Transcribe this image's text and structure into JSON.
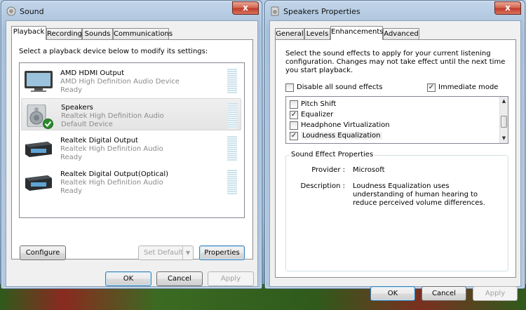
{
  "sound_window": {
    "title": "Sound",
    "close_glyph": "x",
    "tabs": [
      "Playback",
      "Recording",
      "Sounds",
      "Communications"
    ],
    "instruction": "Select a playback device below to modify its settings:",
    "devices": [
      {
        "name": "AMD HDMI Output",
        "driver": "AMD High Definition Audio Device",
        "status": "Ready",
        "icon": "monitor-icon"
      },
      {
        "name": "Speakers",
        "driver": "Realtek High Definition Audio",
        "status": "Default Device",
        "icon": "speaker-icon"
      },
      {
        "name": "Realtek Digital Output",
        "driver": "Realtek High Definition Audio",
        "status": "Ready",
        "icon": "digital-receiver-icon"
      },
      {
        "name": "Realtek Digital Output(Optical)",
        "driver": "Realtek High Definition Audio",
        "status": "Ready",
        "icon": "digital-receiver-icon"
      }
    ],
    "configure_label": "Configure",
    "set_default_label": "Set Default",
    "properties_label": "Properties",
    "ok_label": "OK",
    "cancel_label": "Cancel",
    "apply_label": "Apply"
  },
  "speakers_window": {
    "title": "Speakers Properties",
    "close_glyph": "x",
    "tabs": [
      "General",
      "Levels",
      "Enhancements",
      "Advanced"
    ],
    "instruction": "Select the sound effects to apply for your current listening configuration. Changes may not take effect until the next time you start playback.",
    "disable_all_label": "Disable all sound effects",
    "disable_all_checked": false,
    "immediate_mode_label": "Immediate mode",
    "immediate_mode_checked": true,
    "effects": [
      {
        "label": "Pitch Shift",
        "checked": false
      },
      {
        "label": "Equalizer",
        "checked": true
      },
      {
        "label": "Headphone Virtualization",
        "checked": false
      },
      {
        "label": "Loudness Equalization",
        "checked": true
      }
    ],
    "group_title": "Sound Effect Properties",
    "provider_label": "Provider :",
    "provider_value": "Microsoft",
    "description_label": "Description :",
    "description_value": "Loudness Equalization uses understanding of human hearing to reduce perceived volume differences.",
    "ok_label": "OK",
    "cancel_label": "Cancel",
    "apply_label": "Apply"
  },
  "colors": {
    "accent": "#3c7fb1",
    "selection": "#e6e6e6",
    "check": "#2a8a2a"
  }
}
